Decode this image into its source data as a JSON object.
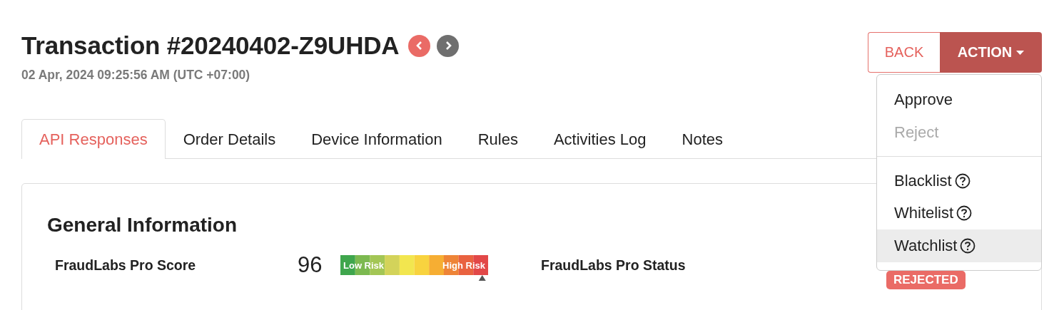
{
  "header": {
    "title": "Transaction #20240402-Z9UHDA",
    "timestamp": "02 Apr, 2024 09:25:56 AM (UTC +07:00)"
  },
  "buttons": {
    "back": "BACK",
    "action": "ACTION"
  },
  "tabs": [
    {
      "label": "API Responses",
      "selected": true
    },
    {
      "label": "Order Details",
      "selected": false
    },
    {
      "label": "Device Information",
      "selected": false
    },
    {
      "label": "Rules",
      "selected": false
    },
    {
      "label": "Activities Log",
      "selected": false
    },
    {
      "label": "Notes",
      "selected": false
    }
  ],
  "action_menu": [
    {
      "label": "Approve",
      "disabled": false,
      "help": false,
      "highlighted": false,
      "divider_before": false
    },
    {
      "label": "Reject",
      "disabled": true,
      "help": false,
      "highlighted": false,
      "divider_before": false
    },
    {
      "label": "Blacklist",
      "disabled": false,
      "help": true,
      "highlighted": false,
      "divider_before": true
    },
    {
      "label": "Whitelist",
      "disabled": false,
      "help": true,
      "highlighted": false,
      "divider_before": false
    },
    {
      "label": "Watchlist",
      "disabled": false,
      "help": true,
      "highlighted": true,
      "divider_before": false
    }
  ],
  "card": {
    "title": "General Information",
    "score_label": "FraudLabs Pro Score",
    "score": "96",
    "meter": {
      "low_label": "Low Risk",
      "high_label": "High Risk",
      "level": 0.96
    },
    "status_label": "FraudLabs Pro Status",
    "status": "REJECTED"
  }
}
